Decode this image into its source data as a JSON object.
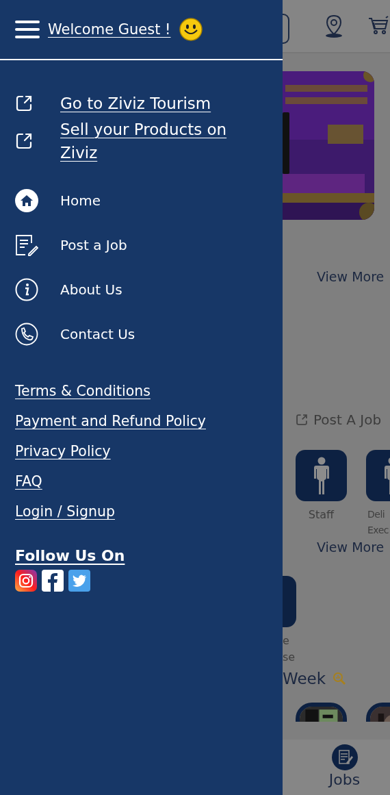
{
  "drawer": {
    "title": "Welcome Guest !",
    "external_links": [
      {
        "label": "Go to Ziviz Tourism"
      },
      {
        "label": "Sell your Products on Ziviz"
      }
    ],
    "menu": [
      {
        "label": "Home",
        "kind": "home"
      },
      {
        "label": "Post a Job",
        "kind": "post"
      },
      {
        "label": "About Us",
        "kind": "about"
      },
      {
        "label": "Contact Us",
        "kind": "contact"
      }
    ],
    "links": [
      "Terms & Conditions",
      "Payment and Refund Policy",
      "Privacy Policy",
      "FAQ",
      "Login / Signup"
    ],
    "follow": {
      "title": "Follow Us On",
      "social": [
        {
          "kind": "instagram"
        },
        {
          "kind": "facebook"
        },
        {
          "kind": "twitter"
        }
      ]
    }
  },
  "page": {
    "view_more": [
      "View More",
      "View More"
    ],
    "post_job": "Post A Job",
    "categories": [
      {
        "lines": [
          "Staff"
        ]
      },
      {
        "lines": [
          "Deli",
          "Exec"
        ]
      }
    ],
    "partial_category": {
      "lines": [
        "e",
        "se"
      ]
    },
    "section_title": "Week",
    "nav": {
      "label": "Jobs"
    }
  }
}
